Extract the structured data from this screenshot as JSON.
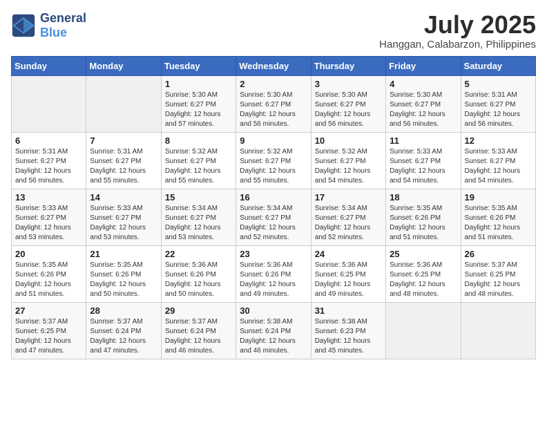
{
  "header": {
    "logo_line1": "General",
    "logo_line2": "Blue",
    "month_year": "July 2025",
    "location": "Hanggan, Calabarzon, Philippines"
  },
  "weekdays": [
    "Sunday",
    "Monday",
    "Tuesday",
    "Wednesday",
    "Thursday",
    "Friday",
    "Saturday"
  ],
  "weeks": [
    [
      {
        "day": "",
        "info": ""
      },
      {
        "day": "",
        "info": ""
      },
      {
        "day": "1",
        "info": "Sunrise: 5:30 AM\nSunset: 6:27 PM\nDaylight: 12 hours\nand 57 minutes."
      },
      {
        "day": "2",
        "info": "Sunrise: 5:30 AM\nSunset: 6:27 PM\nDaylight: 12 hours\nand 56 minutes."
      },
      {
        "day": "3",
        "info": "Sunrise: 5:30 AM\nSunset: 6:27 PM\nDaylight: 12 hours\nand 56 minutes."
      },
      {
        "day": "4",
        "info": "Sunrise: 5:30 AM\nSunset: 6:27 PM\nDaylight: 12 hours\nand 56 minutes."
      },
      {
        "day": "5",
        "info": "Sunrise: 5:31 AM\nSunset: 6:27 PM\nDaylight: 12 hours\nand 56 minutes."
      }
    ],
    [
      {
        "day": "6",
        "info": "Sunrise: 5:31 AM\nSunset: 6:27 PM\nDaylight: 12 hours\nand 56 minutes."
      },
      {
        "day": "7",
        "info": "Sunrise: 5:31 AM\nSunset: 6:27 PM\nDaylight: 12 hours\nand 55 minutes."
      },
      {
        "day": "8",
        "info": "Sunrise: 5:32 AM\nSunset: 6:27 PM\nDaylight: 12 hours\nand 55 minutes."
      },
      {
        "day": "9",
        "info": "Sunrise: 5:32 AM\nSunset: 6:27 PM\nDaylight: 12 hours\nand 55 minutes."
      },
      {
        "day": "10",
        "info": "Sunrise: 5:32 AM\nSunset: 6:27 PM\nDaylight: 12 hours\nand 54 minutes."
      },
      {
        "day": "11",
        "info": "Sunrise: 5:33 AM\nSunset: 6:27 PM\nDaylight: 12 hours\nand 54 minutes."
      },
      {
        "day": "12",
        "info": "Sunrise: 5:33 AM\nSunset: 6:27 PM\nDaylight: 12 hours\nand 54 minutes."
      }
    ],
    [
      {
        "day": "13",
        "info": "Sunrise: 5:33 AM\nSunset: 6:27 PM\nDaylight: 12 hours\nand 53 minutes."
      },
      {
        "day": "14",
        "info": "Sunrise: 5:33 AM\nSunset: 6:27 PM\nDaylight: 12 hours\nand 53 minutes."
      },
      {
        "day": "15",
        "info": "Sunrise: 5:34 AM\nSunset: 6:27 PM\nDaylight: 12 hours\nand 53 minutes."
      },
      {
        "day": "16",
        "info": "Sunrise: 5:34 AM\nSunset: 6:27 PM\nDaylight: 12 hours\nand 52 minutes."
      },
      {
        "day": "17",
        "info": "Sunrise: 5:34 AM\nSunset: 6:27 PM\nDaylight: 12 hours\nand 52 minutes."
      },
      {
        "day": "18",
        "info": "Sunrise: 5:35 AM\nSunset: 6:26 PM\nDaylight: 12 hours\nand 51 minutes."
      },
      {
        "day": "19",
        "info": "Sunrise: 5:35 AM\nSunset: 6:26 PM\nDaylight: 12 hours\nand 51 minutes."
      }
    ],
    [
      {
        "day": "20",
        "info": "Sunrise: 5:35 AM\nSunset: 6:26 PM\nDaylight: 12 hours\nand 51 minutes."
      },
      {
        "day": "21",
        "info": "Sunrise: 5:35 AM\nSunset: 6:26 PM\nDaylight: 12 hours\nand 50 minutes."
      },
      {
        "day": "22",
        "info": "Sunrise: 5:36 AM\nSunset: 6:26 PM\nDaylight: 12 hours\nand 50 minutes."
      },
      {
        "day": "23",
        "info": "Sunrise: 5:36 AM\nSunset: 6:26 PM\nDaylight: 12 hours\nand 49 minutes."
      },
      {
        "day": "24",
        "info": "Sunrise: 5:36 AM\nSunset: 6:25 PM\nDaylight: 12 hours\nand 49 minutes."
      },
      {
        "day": "25",
        "info": "Sunrise: 5:36 AM\nSunset: 6:25 PM\nDaylight: 12 hours\nand 48 minutes."
      },
      {
        "day": "26",
        "info": "Sunrise: 5:37 AM\nSunset: 6:25 PM\nDaylight: 12 hours\nand 48 minutes."
      }
    ],
    [
      {
        "day": "27",
        "info": "Sunrise: 5:37 AM\nSunset: 6:25 PM\nDaylight: 12 hours\nand 47 minutes."
      },
      {
        "day": "28",
        "info": "Sunrise: 5:37 AM\nSunset: 6:24 PM\nDaylight: 12 hours\nand 47 minutes."
      },
      {
        "day": "29",
        "info": "Sunrise: 5:37 AM\nSunset: 6:24 PM\nDaylight: 12 hours\nand 46 minutes."
      },
      {
        "day": "30",
        "info": "Sunrise: 5:38 AM\nSunset: 6:24 PM\nDaylight: 12 hours\nand 46 minutes."
      },
      {
        "day": "31",
        "info": "Sunrise: 5:38 AM\nSunset: 6:23 PM\nDaylight: 12 hours\nand 45 minutes."
      },
      {
        "day": "",
        "info": ""
      },
      {
        "day": "",
        "info": ""
      }
    ]
  ]
}
